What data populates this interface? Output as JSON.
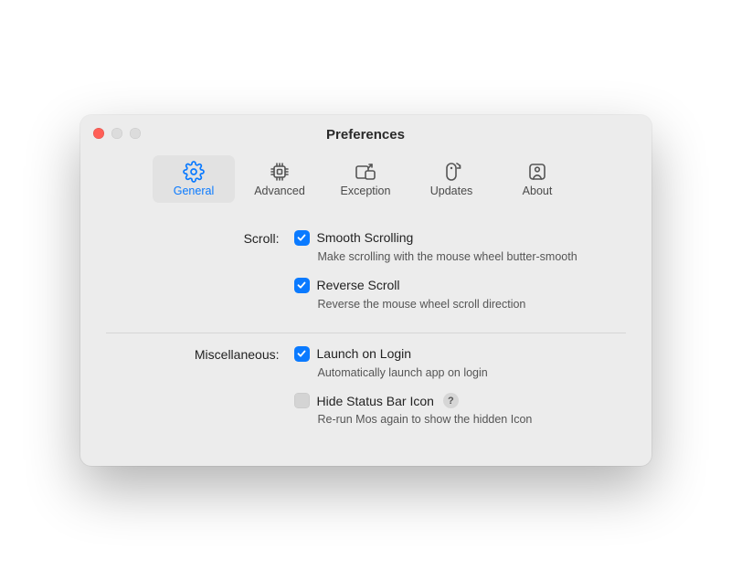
{
  "window": {
    "title": "Preferences"
  },
  "tabs": [
    {
      "label": "General"
    },
    {
      "label": "Advanced"
    },
    {
      "label": "Exception"
    },
    {
      "label": "Updates"
    },
    {
      "label": "About"
    }
  ],
  "sections": {
    "scroll": {
      "label": "Scroll:",
      "options": [
        {
          "title": "Smooth Scrolling",
          "desc": "Make scrolling with the mouse wheel butter-smooth"
        },
        {
          "title": "Reverse Scroll",
          "desc": "Reverse the mouse wheel scroll direction"
        }
      ]
    },
    "misc": {
      "label": "Miscellaneous:",
      "options": [
        {
          "title": "Launch on Login",
          "desc": "Automatically launch app on login"
        },
        {
          "title": "Hide Status Bar Icon",
          "desc": "Re-run Mos again to show the hidden Icon"
        }
      ]
    }
  },
  "help_glyph": "?"
}
